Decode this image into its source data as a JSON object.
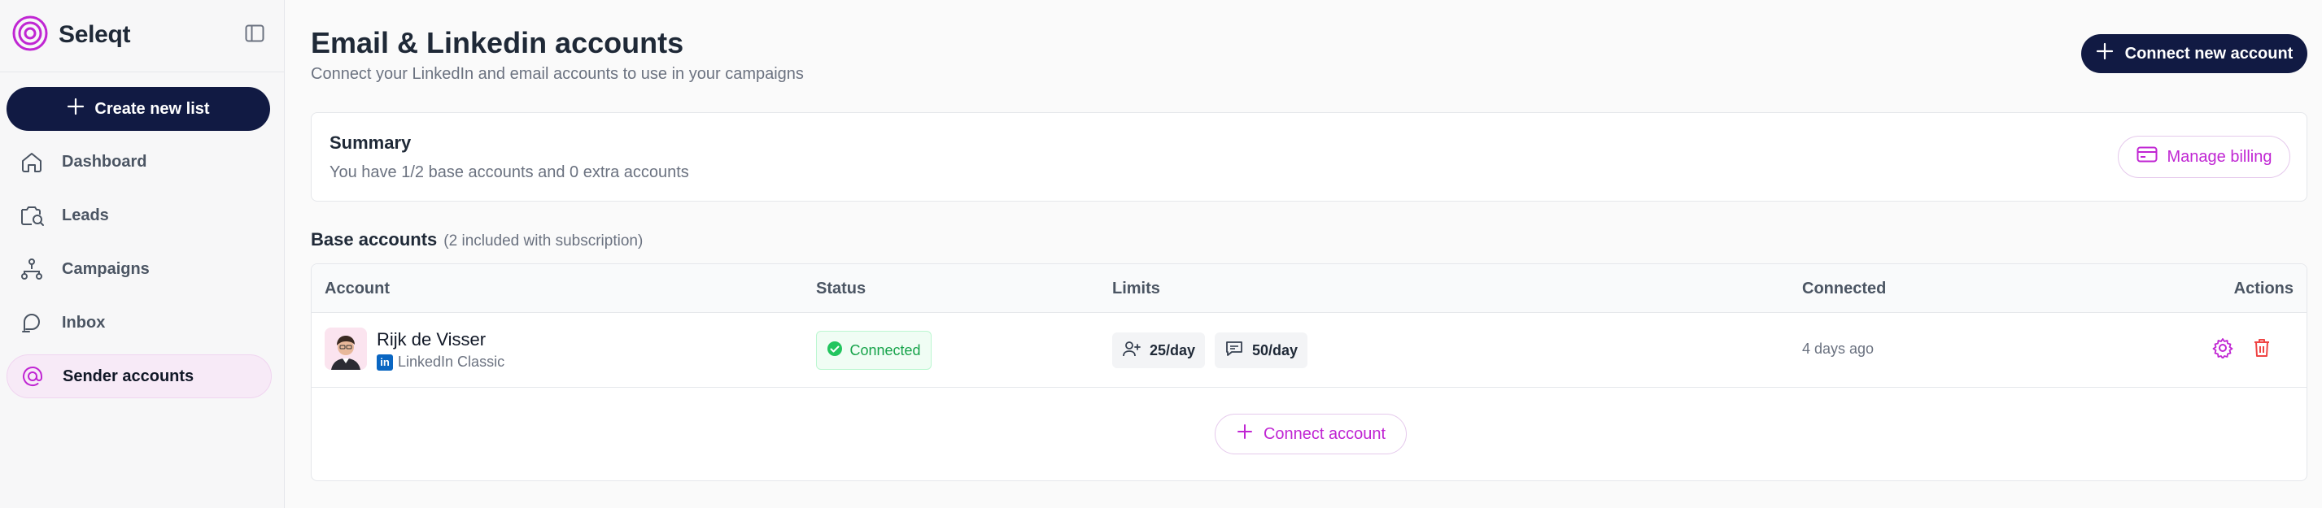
{
  "app": {
    "brand_name": "Seleqt",
    "accent_color": "#c026d3",
    "primary_color": "#111a43"
  },
  "sidebar": {
    "create_button_label": "Create new list",
    "items": [
      {
        "label": "Dashboard",
        "icon": "home-icon"
      },
      {
        "label": "Leads",
        "icon": "leads-search-icon"
      },
      {
        "label": "Campaigns",
        "icon": "campaigns-flow-icon"
      },
      {
        "label": "Inbox",
        "icon": "inbox-chat-icon"
      },
      {
        "label": "Sender accounts",
        "icon": "at-sign-icon",
        "active": true
      }
    ]
  },
  "header": {
    "title": "Email & Linkedin accounts",
    "subtitle": "Connect your LinkedIn and email accounts to use in your campaigns",
    "connect_new_label": "Connect new account"
  },
  "summary": {
    "title": "Summary",
    "text": "You have 1/2 base accounts and 0 extra accounts",
    "billing_label": "Manage billing"
  },
  "base_accounts": {
    "heading": "Base accounts",
    "note": "(2 included with subscription)",
    "columns": {
      "account": "Account",
      "status": "Status",
      "limits": "Limits",
      "connected": "Connected",
      "actions": "Actions"
    },
    "rows": [
      {
        "name": "Rijk de Visser",
        "account_type": "LinkedIn Classic",
        "status": "Connected",
        "limit_invites": "25/day",
        "limit_messages": "50/day",
        "connected": "4 days ago"
      }
    ],
    "connect_account_label": "Connect account"
  }
}
